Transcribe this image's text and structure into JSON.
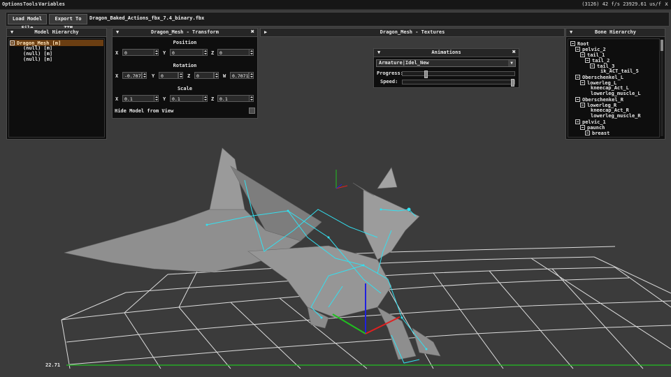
{
  "menu": {
    "options": "Options",
    "tools": "Tools",
    "variables": "Variables",
    "stats": "(3126) 42 f/s 23929.61 us/f",
    "close": "x"
  },
  "toolbar": {
    "load": "Load Model File",
    "export": "Export To ZTM",
    "filename": "Dragon_Baked_Actions_fbx_7.4_binary.fbx"
  },
  "model_hierarchy": {
    "title": "Model Hierarchy",
    "items": [
      "Dragon_Mesh [m]",
      "(null) [m]",
      "(null) [m]",
      "(null) [m]"
    ]
  },
  "transform": {
    "title": "Dragon_Mesh - Transform",
    "position_label": "Position",
    "position": {
      "x": "0",
      "y": "0",
      "z": "0"
    },
    "rotation_label": "Rotation",
    "rotation": {
      "x": "-0.7071",
      "y": "0",
      "z": "0",
      "w": "0.7071"
    },
    "scale_label": "Scale",
    "scale": {
      "x": "0.1",
      "y": "0.1",
      "z": "0.1"
    },
    "axis": {
      "x": "X",
      "y": "Y",
      "z": "Z",
      "w": "W"
    },
    "hide_label": "Hide Model from View",
    "hide_checked": false
  },
  "textures": {
    "title": "Dragon_Mesh - Textures"
  },
  "animations": {
    "title": "Animations",
    "selected": "Armature|Idel_New",
    "progress_label": "Progress:",
    "progress": 0.2,
    "speed_label": "Speed:",
    "speed": 1.0
  },
  "bone_hierarchy": {
    "title": "Bone Hierarchy",
    "items": [
      {
        "label": "Root",
        "depth": 0,
        "box": true
      },
      {
        "label": "pelvic_2",
        "depth": 1,
        "box": true
      },
      {
        "label": "tail_1",
        "depth": 2,
        "box": true
      },
      {
        "label": "tail_2",
        "depth": 3,
        "box": true
      },
      {
        "label": "tail_3",
        "depth": 4,
        "box": true
      },
      {
        "label": "ik_ACT_tail_5",
        "depth": 5,
        "box": false
      },
      {
        "label": "Oberschenkel_L",
        "depth": 1,
        "box": true
      },
      {
        "label": "lowerleg_L",
        "depth": 2,
        "box": true
      },
      {
        "label": "kneecap_Act_L",
        "depth": 3,
        "box": false
      },
      {
        "label": "lowerleg_muscle_L",
        "depth": 3,
        "box": false
      },
      {
        "label": "Oberschenkel_R",
        "depth": 1,
        "box": true
      },
      {
        "label": "lowerleg_R",
        "depth": 2,
        "box": true
      },
      {
        "label": "kneecap_Act_R",
        "depth": 3,
        "box": false
      },
      {
        "label": "lowerleg_muscle_R",
        "depth": 3,
        "box": false
      },
      {
        "label": "pelvic_1",
        "depth": 1,
        "box": true
      },
      {
        "label": "paunch",
        "depth": 2,
        "box": true
      },
      {
        "label": "breast",
        "depth": 3,
        "box": true
      }
    ]
  },
  "viewport": {
    "coord_readout": "22.71"
  },
  "colors": {
    "grid": "#d9d9d9",
    "skeleton": "#33e0f0",
    "mesh": "#8d8d8d",
    "axis_x": "#e02020",
    "axis_y": "#20c020",
    "axis_z": "#2020e0",
    "selection": "#6b3e12"
  }
}
